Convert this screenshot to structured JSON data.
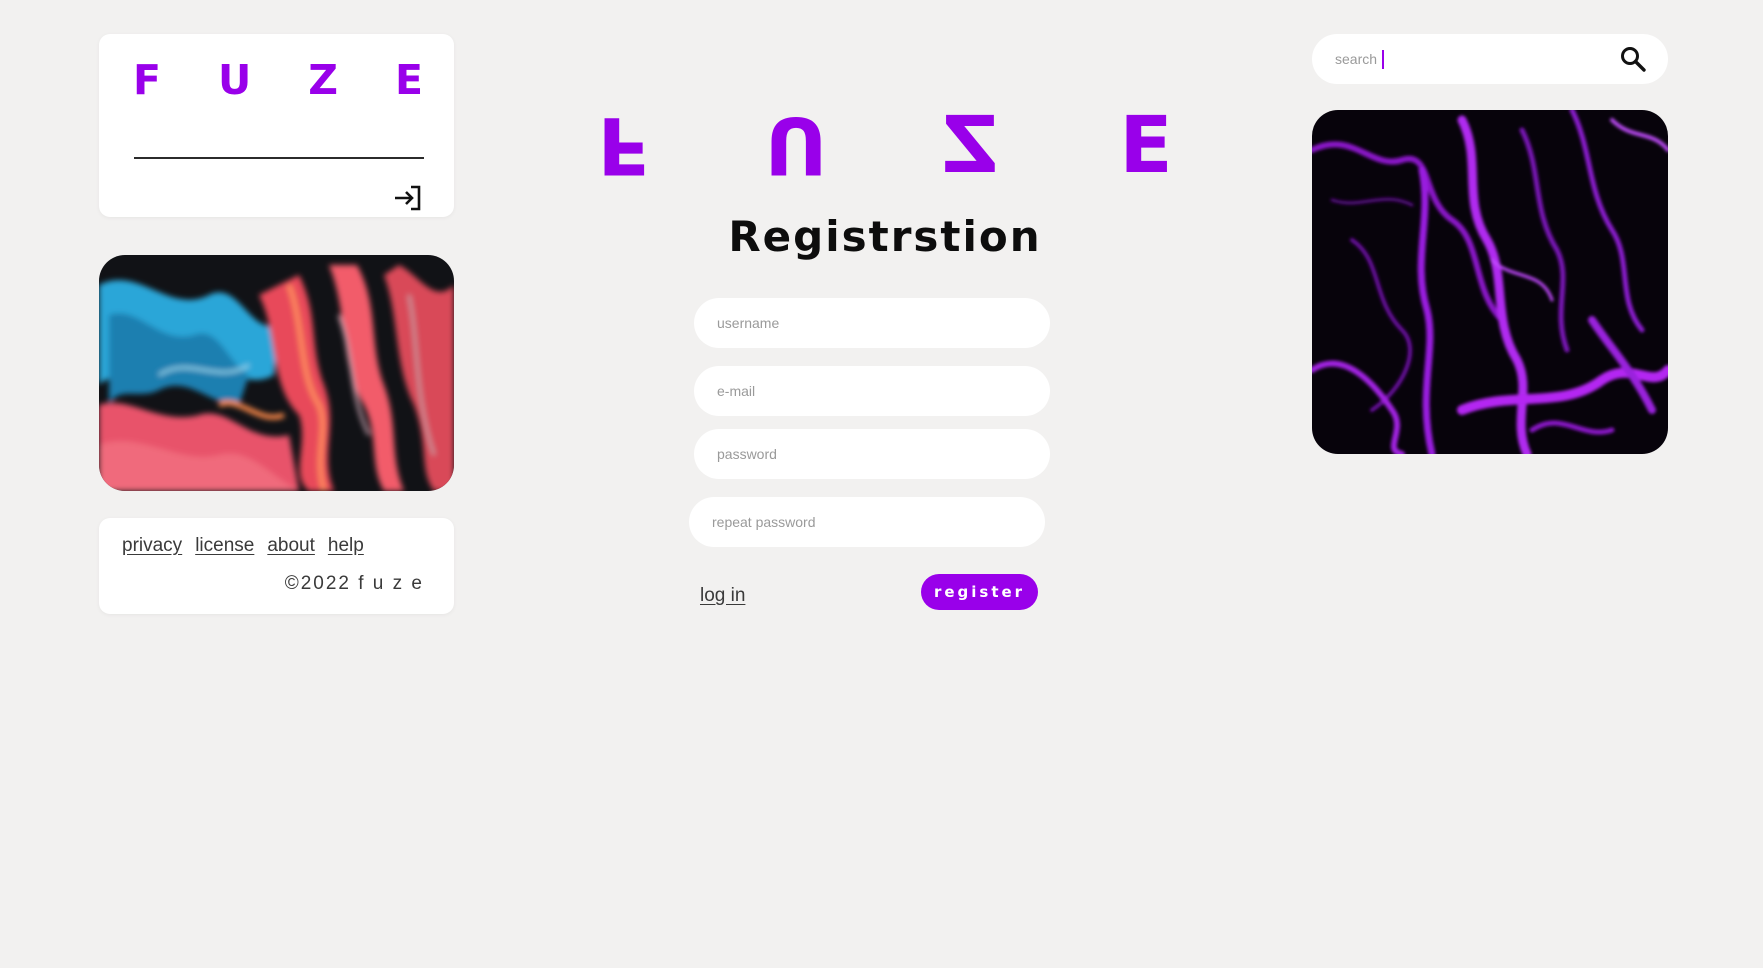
{
  "logo": {
    "letters": [
      "F",
      "U",
      "Z",
      "E"
    ]
  },
  "header": {
    "big_logo_letters": [
      "F",
      "U",
      "Z",
      "E"
    ]
  },
  "icons": {
    "login": "login-icon",
    "search": "search-icon"
  },
  "footer": {
    "links": [
      "privacy",
      "license",
      "about",
      "help"
    ],
    "copyright": "©2022  f u z e"
  },
  "form": {
    "title": "Registrstion",
    "username_placeholder": "username",
    "email_placeholder": "e-mail",
    "password_placeholder": "password",
    "repeat_password_placeholder": "repeat password",
    "login_link": "log in",
    "register_button": "register"
  },
  "search": {
    "value": "search"
  },
  "colors": {
    "accent": "#9900ea",
    "background": "#f2f1f0",
    "card": "#ffffff",
    "text": "#0d0d0d"
  }
}
